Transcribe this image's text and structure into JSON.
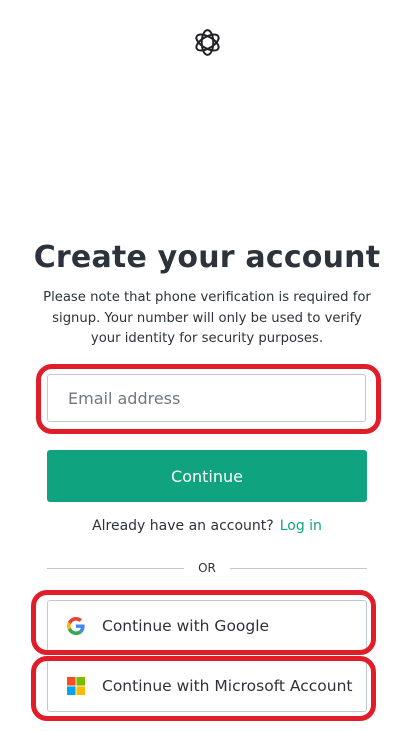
{
  "page": {
    "title": "Create your account",
    "subtitle": "Please note that phone verification is required for signup. Your number will only be used to verify your identity for security purposes."
  },
  "form": {
    "email_placeholder": "Email address",
    "email_value": "",
    "continue_label": "Continue"
  },
  "login": {
    "prompt": "Already have an account?",
    "link_label": "Log in"
  },
  "divider": {
    "label": "OR"
  },
  "social": {
    "google": {
      "label": "Continue with Google",
      "icon": "google-icon"
    },
    "microsoft": {
      "label": "Continue with Microsoft Account",
      "icon": "microsoft-icon"
    }
  },
  "colors": {
    "accent": "#10a37f",
    "text": "#2d333a",
    "border": "#c2c8d0",
    "annotation": "#e01e2a"
  }
}
